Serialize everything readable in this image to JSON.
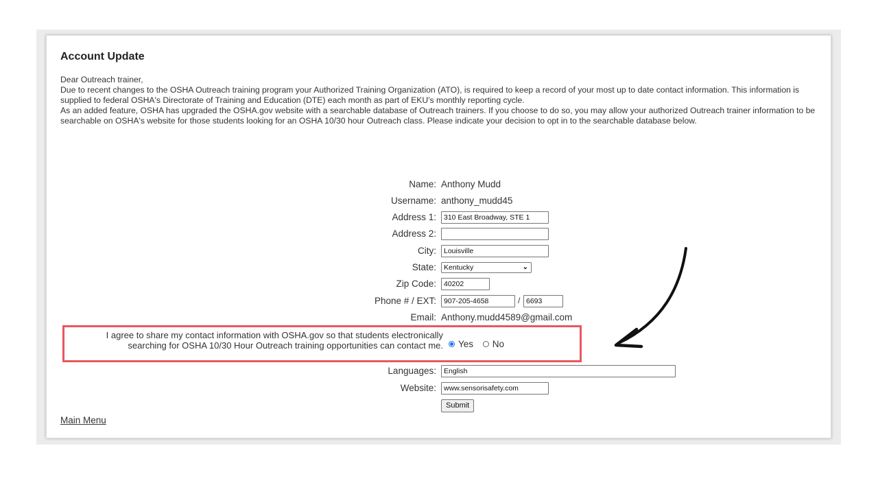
{
  "page": {
    "title": "Account Update",
    "intro": [
      "Dear Outreach trainer,",
      "Due to recent changes to the OSHA Outreach training program your Authorized Training Organization (ATO), is required to keep a record of your most up to date contact information. This information is supplied to federal OSHA's Directorate of Training and Education (DTE) each month as part of EKU's monthly reporting cycle.",
      "As an added feature, OSHA has upgraded the OSHA.gov website with a searchable database of Outreach trainers. If you choose to do so, you may allow your authorized Outreach trainer information to be searchable on OSHA's website for those students looking for an OSHA 10/30 hour Outreach class. Please indicate your decision to opt in to the searchable database below."
    ]
  },
  "form": {
    "name_label": "Name:",
    "name_value": "Anthony Mudd",
    "username_label": "Username:",
    "username_value": "anthony_mudd45",
    "address1_label": "Address 1:",
    "address1_value": "310 East Broadway, STE 1",
    "address2_label": "Address 2:",
    "address2_value": "",
    "city_label": "City:",
    "city_value": "Louisville",
    "state_label": "State:",
    "state_value": "Kentucky",
    "zip_label": "Zip Code:",
    "zip_value": "40202",
    "phone_label": "Phone # / EXT:",
    "phone_value": "907-205-4658",
    "phone_sep": "/",
    "ext_value": "6693",
    "email_label": "Email:",
    "email_value": "Anthony.mudd4589@gmail.com",
    "consent_text": "I agree to share my contact information with OSHA.gov so that students electronically searching for OSHA 10/30 Hour Outreach training opportunities can contact me.",
    "consent_yes": "Yes",
    "consent_no": "No",
    "consent_selected": "Yes",
    "languages_label": "Languages:",
    "languages_value": "English",
    "website_label": "Website:",
    "website_value": "www.sensorisafety.com",
    "submit_label": "Submit"
  },
  "footer": {
    "main_menu": "Main Menu"
  },
  "colors": {
    "highlight_border": "#e8575e",
    "radio_accent": "#1a73e8"
  }
}
